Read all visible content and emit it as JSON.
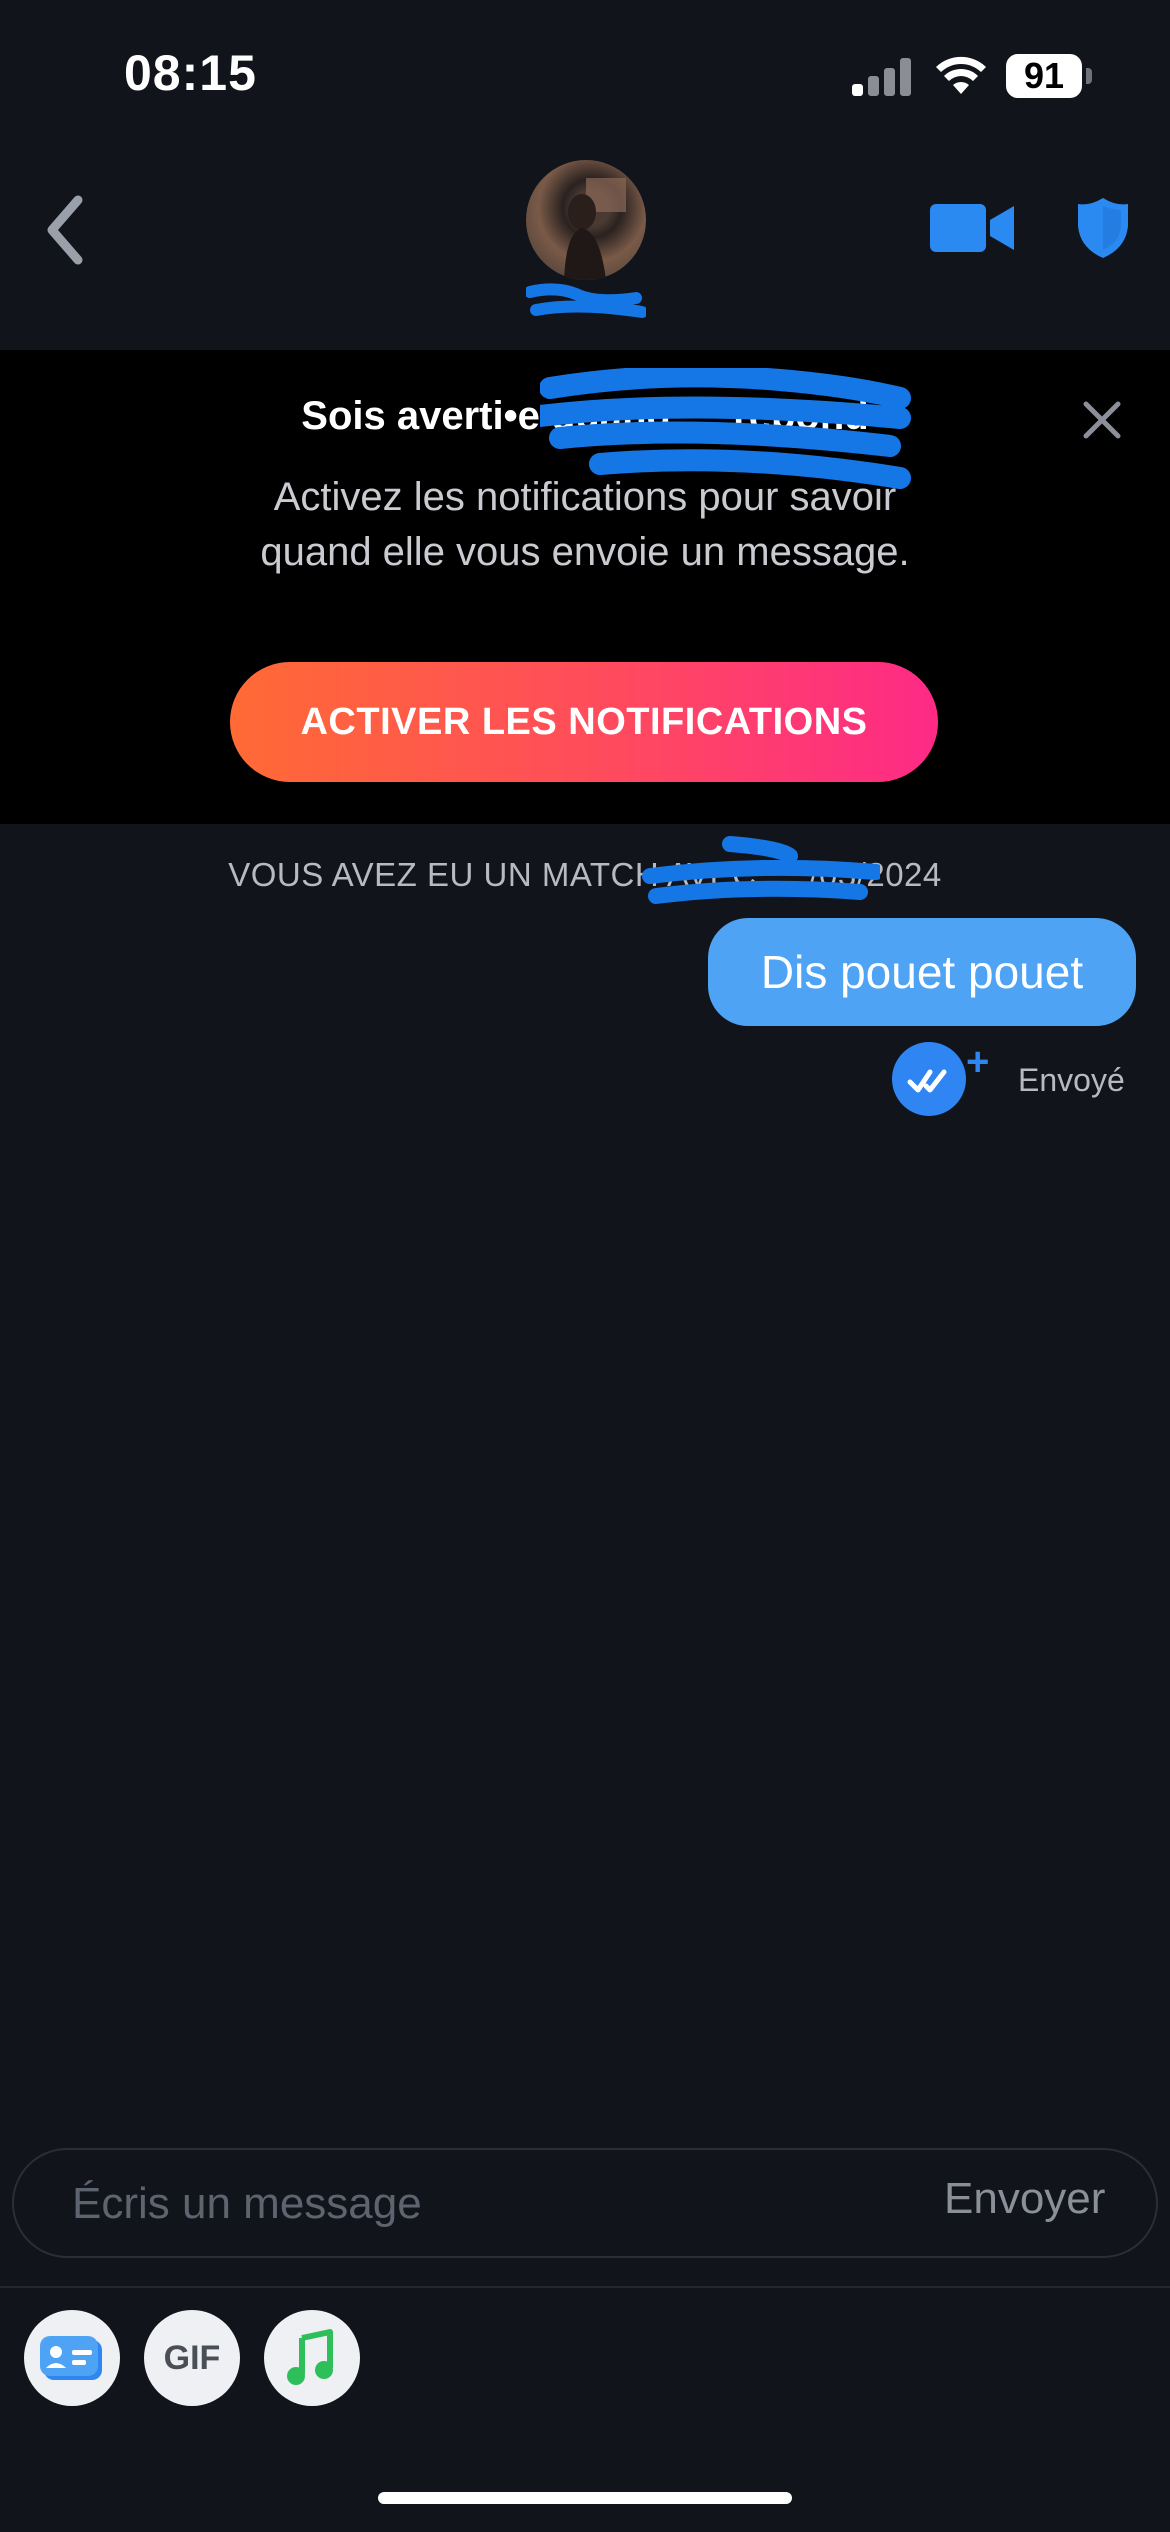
{
  "status_bar": {
    "time": "08:15",
    "battery": "91"
  },
  "header": {
    "back_icon": "chevron-left-icon",
    "video_icon": "video-camera-icon",
    "safety_icon": "shield-icon"
  },
  "banner": {
    "title": "Sois averti•e quand … répond",
    "body": "Activez les notifications pour savoir quand elle vous envoie un message.",
    "cta_label": "ACTIVER LES NOTIFICATIONS",
    "gradient_start": "#ff6a35",
    "gradient_end": "#fe2a86"
  },
  "chat": {
    "match_line": "VOUS AVEZ EU UN MATCH AVEC … /03/2024",
    "messages": [
      {
        "text": "Dis pouet pouet",
        "from": "me",
        "status": "Envoyé"
      }
    ],
    "accent": "#4ea3f5"
  },
  "composer": {
    "placeholder": "Écris un message",
    "send_label": "Envoyer"
  },
  "toolbar": {
    "gif_label": "GIF"
  }
}
